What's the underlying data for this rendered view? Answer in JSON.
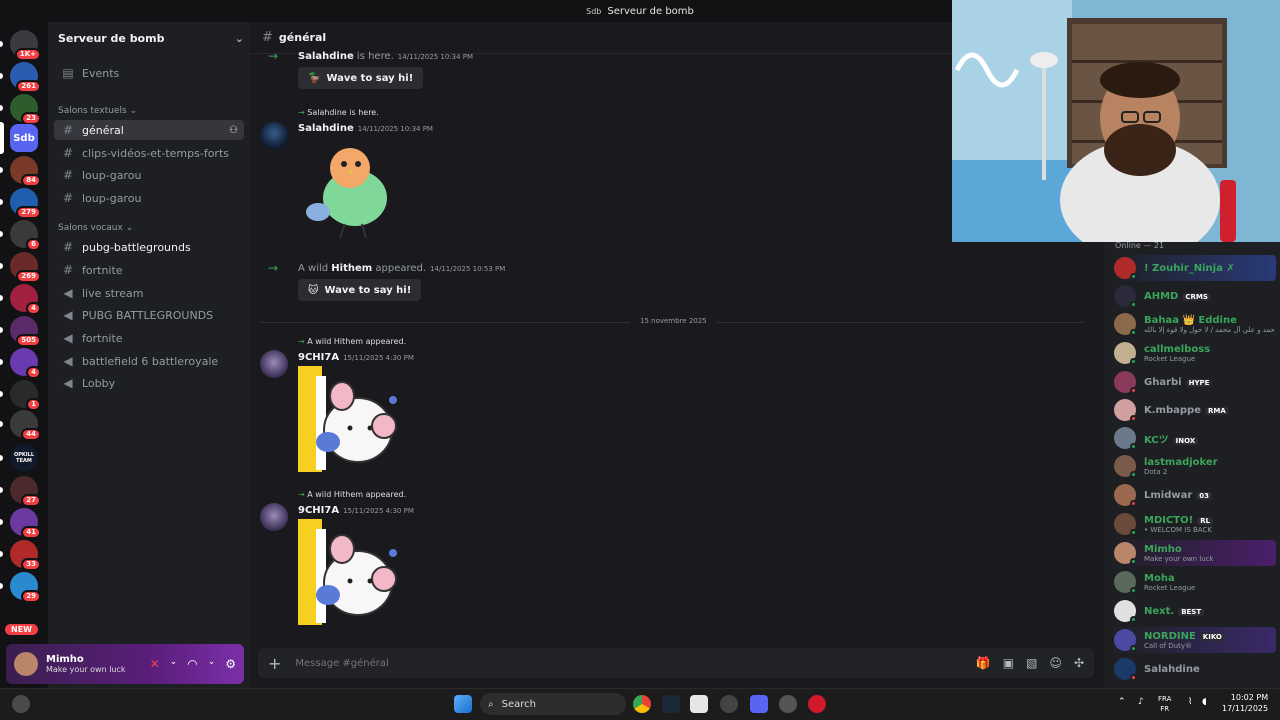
{
  "window_title": "Serveur de bomb",
  "window_logo": "Sdb",
  "server_rail": [
    {
      "badge": "1K+",
      "color": "#3a3a3f"
    },
    {
      "badge": "261",
      "color": "#2a5db0"
    },
    {
      "badge": "23",
      "color": "#2d5d2d"
    },
    {
      "badge": "",
      "label": "Sdb",
      "color": "#5865f2"
    },
    {
      "badge": "84",
      "color": "#7a3a2a"
    },
    {
      "badge": "279",
      "color": "#1f5fae"
    },
    {
      "badge": "6",
      "color": "#3a3a3a"
    },
    {
      "badge": "269",
      "color": "#6a2a2a"
    },
    {
      "badge": "4",
      "color": "#a02040"
    },
    {
      "badge": "505",
      "color": "#5a2a6a"
    },
    {
      "badge": "4",
      "color": "#6a3ab0"
    },
    {
      "badge": "1",
      "color": "#2a2a2a"
    },
    {
      "badge": "44",
      "color": "#3a3a3a"
    },
    {
      "badge": "",
      "label": "OPKILL TEAM",
      "color": "#0f1a2a"
    },
    {
      "badge": "27",
      "color": "#4a2a2a"
    },
    {
      "badge": "41",
      "color": "#6a3aa0"
    },
    {
      "badge": "33",
      "color": "#b02a2a"
    },
    {
      "badge": "29",
      "color": "#2a8ad0"
    }
  ],
  "new_badge": "NEW",
  "server_name": "Serveur de bomb",
  "events_label": "Events",
  "cat_text": "Salons textuels",
  "cat_voice": "Salons vocaux",
  "text_channels": [
    "général",
    "clips-vidéos-et-temps-forts",
    "loup-garou",
    "loup-garou"
  ],
  "voice_channels": [
    "pubg-battlegrounds",
    "fortnite",
    "live stream",
    "PUBG BATTLEGROUNDS",
    "fortnite",
    "battlefield 6 battleroyale",
    "Lobby"
  ],
  "user_panel": {
    "name": "Mimho",
    "status": "Make your own luck"
  },
  "chat_header": "général",
  "messages": {
    "m1_name": "Salahdine",
    "m1_action": " is here.",
    "m1_time": "14/11/2025 10:34 PM",
    "m1_wave": "Wave to say hi!",
    "m2_reply": "Salahdine is here.",
    "m2_name": "Salahdine",
    "m2_time": "14/11/2025 10:34 PM",
    "m3_pre": "A wild ",
    "m3_name": "Hithem",
    "m3_post": " appeared.",
    "m3_time": "14/11/2025 10:53 PM",
    "m3_wave": "Wave to say hi!",
    "divider": "15 novembre 2025",
    "m4_reply": "A wild Hithem appeared.",
    "m4_name": "9CHI7A",
    "m4_time": "15/11/2025 4:30 PM",
    "m5_reply": "A wild Hithem appeared.",
    "m5_name": "9CHI7A",
    "m5_time": "15/11/2025 4:30 PM"
  },
  "composer_placeholder": "Message #général",
  "online_header": "Online — 21",
  "members": [
    {
      "name": "! Zouhir_Ninja ✗",
      "sub": "",
      "tag": "",
      "color": "#3ba55c",
      "hl": "#2a3a7a"
    },
    {
      "name": "AHMD",
      "sub": "",
      "tag": "CRMS",
      "color": "#3ba55c",
      "hl": ""
    },
    {
      "name": "Bahaa 👑 Eddine",
      "sub": "محمد و علي آل محمد / لا حول ولا قوة إلا بالله ...",
      "tag": "",
      "color": "#3ba55c",
      "hl": ""
    },
    {
      "name": "callmelboss",
      "sub": "Rocket League",
      "tag": "",
      "color": "#3ba55c",
      "hl": ""
    },
    {
      "name": "Gharbi",
      "sub": "",
      "tag": "HYPE",
      "color": "#949ba4",
      "hl": ""
    },
    {
      "name": "K.mbappe",
      "sub": "",
      "tag": "RMA",
      "color": "#949ba4",
      "hl": ""
    },
    {
      "name": "KCツ",
      "sub": "",
      "tag": "INOX",
      "color": "#3ba55c",
      "hl": ""
    },
    {
      "name": "lastmadjoker",
      "sub": "Dota 2",
      "tag": "",
      "color": "#3ba55c",
      "hl": ""
    },
    {
      "name": "Lmidwar",
      "sub": "",
      "tag": "03",
      "color": "#949ba4",
      "hl": ""
    },
    {
      "name": "MDICTO!",
      "sub": "• WELCOM IS BACK",
      "tag": "RL",
      "color": "#3ba55c",
      "hl": ""
    },
    {
      "name": "Mimho",
      "sub": "Make your own luck",
      "tag": "",
      "color": "#3ba55c",
      "hl": "#4a1f6a"
    },
    {
      "name": "Moha",
      "sub": "Rocket League",
      "tag": "",
      "color": "#3ba55c",
      "hl": ""
    },
    {
      "name": "Next.",
      "sub": "",
      "tag": "BEST",
      "color": "#3ba55c",
      "hl": ""
    },
    {
      "name": "NORDINE",
      "sub": "Call of Duty®",
      "tag": "KIKO",
      "color": "#3ba55c",
      "hl": "#3a2a6a"
    },
    {
      "name": "Salahdine",
      "sub": "",
      "tag": "",
      "color": "#949ba4",
      "hl": ""
    }
  ],
  "taskbar": {
    "search": "Search",
    "lang1": "FRA",
    "lang2": "FR",
    "time": "10:02 PM",
    "date": "17/11/2025"
  }
}
